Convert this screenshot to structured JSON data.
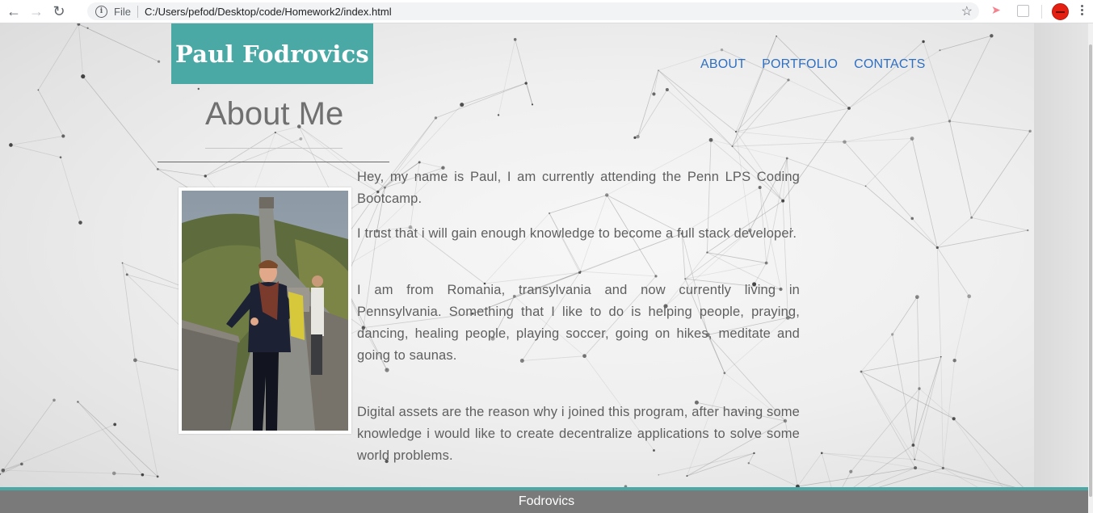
{
  "browser": {
    "scheme_label": "File",
    "url": "C:/Users/pefod/Desktop/code/Homework2/index.html"
  },
  "site": {
    "brand": "Paul Fodrovics",
    "nav": [
      "ABOUT",
      "PORTFOLIO",
      "CONTACTS"
    ],
    "heading": "About Me",
    "paragraphs": [
      "Hey, my name is Paul, I am currently attending the Penn LPS Coding Bootcamp.",
      "I trust that i will gain enough knowledge to become a full stack developer.",
      "I am from Romania, transylvania and now currently living in Pennsylvania. Something that I like to do is helping people, praying, dancing, healing people, playing soccer, going on hikes, meditate and going to saunas.",
      "Digital assets are the reason why i joined this program, after having some knowledge i would like to create decentralize applications to solve some world problems."
    ],
    "footer": "Fodrovics"
  },
  "colors": {
    "brand_bg": "#4aa8a5",
    "nav_link": "#2e6fc3",
    "footer_bg": "#7a7a7a",
    "text": "#5f5f5f"
  },
  "icons": {
    "back": "arrow-left",
    "forward": "arrow-right",
    "reload": "reload",
    "info": "info",
    "bookmark": "star",
    "profile": "avatar"
  }
}
